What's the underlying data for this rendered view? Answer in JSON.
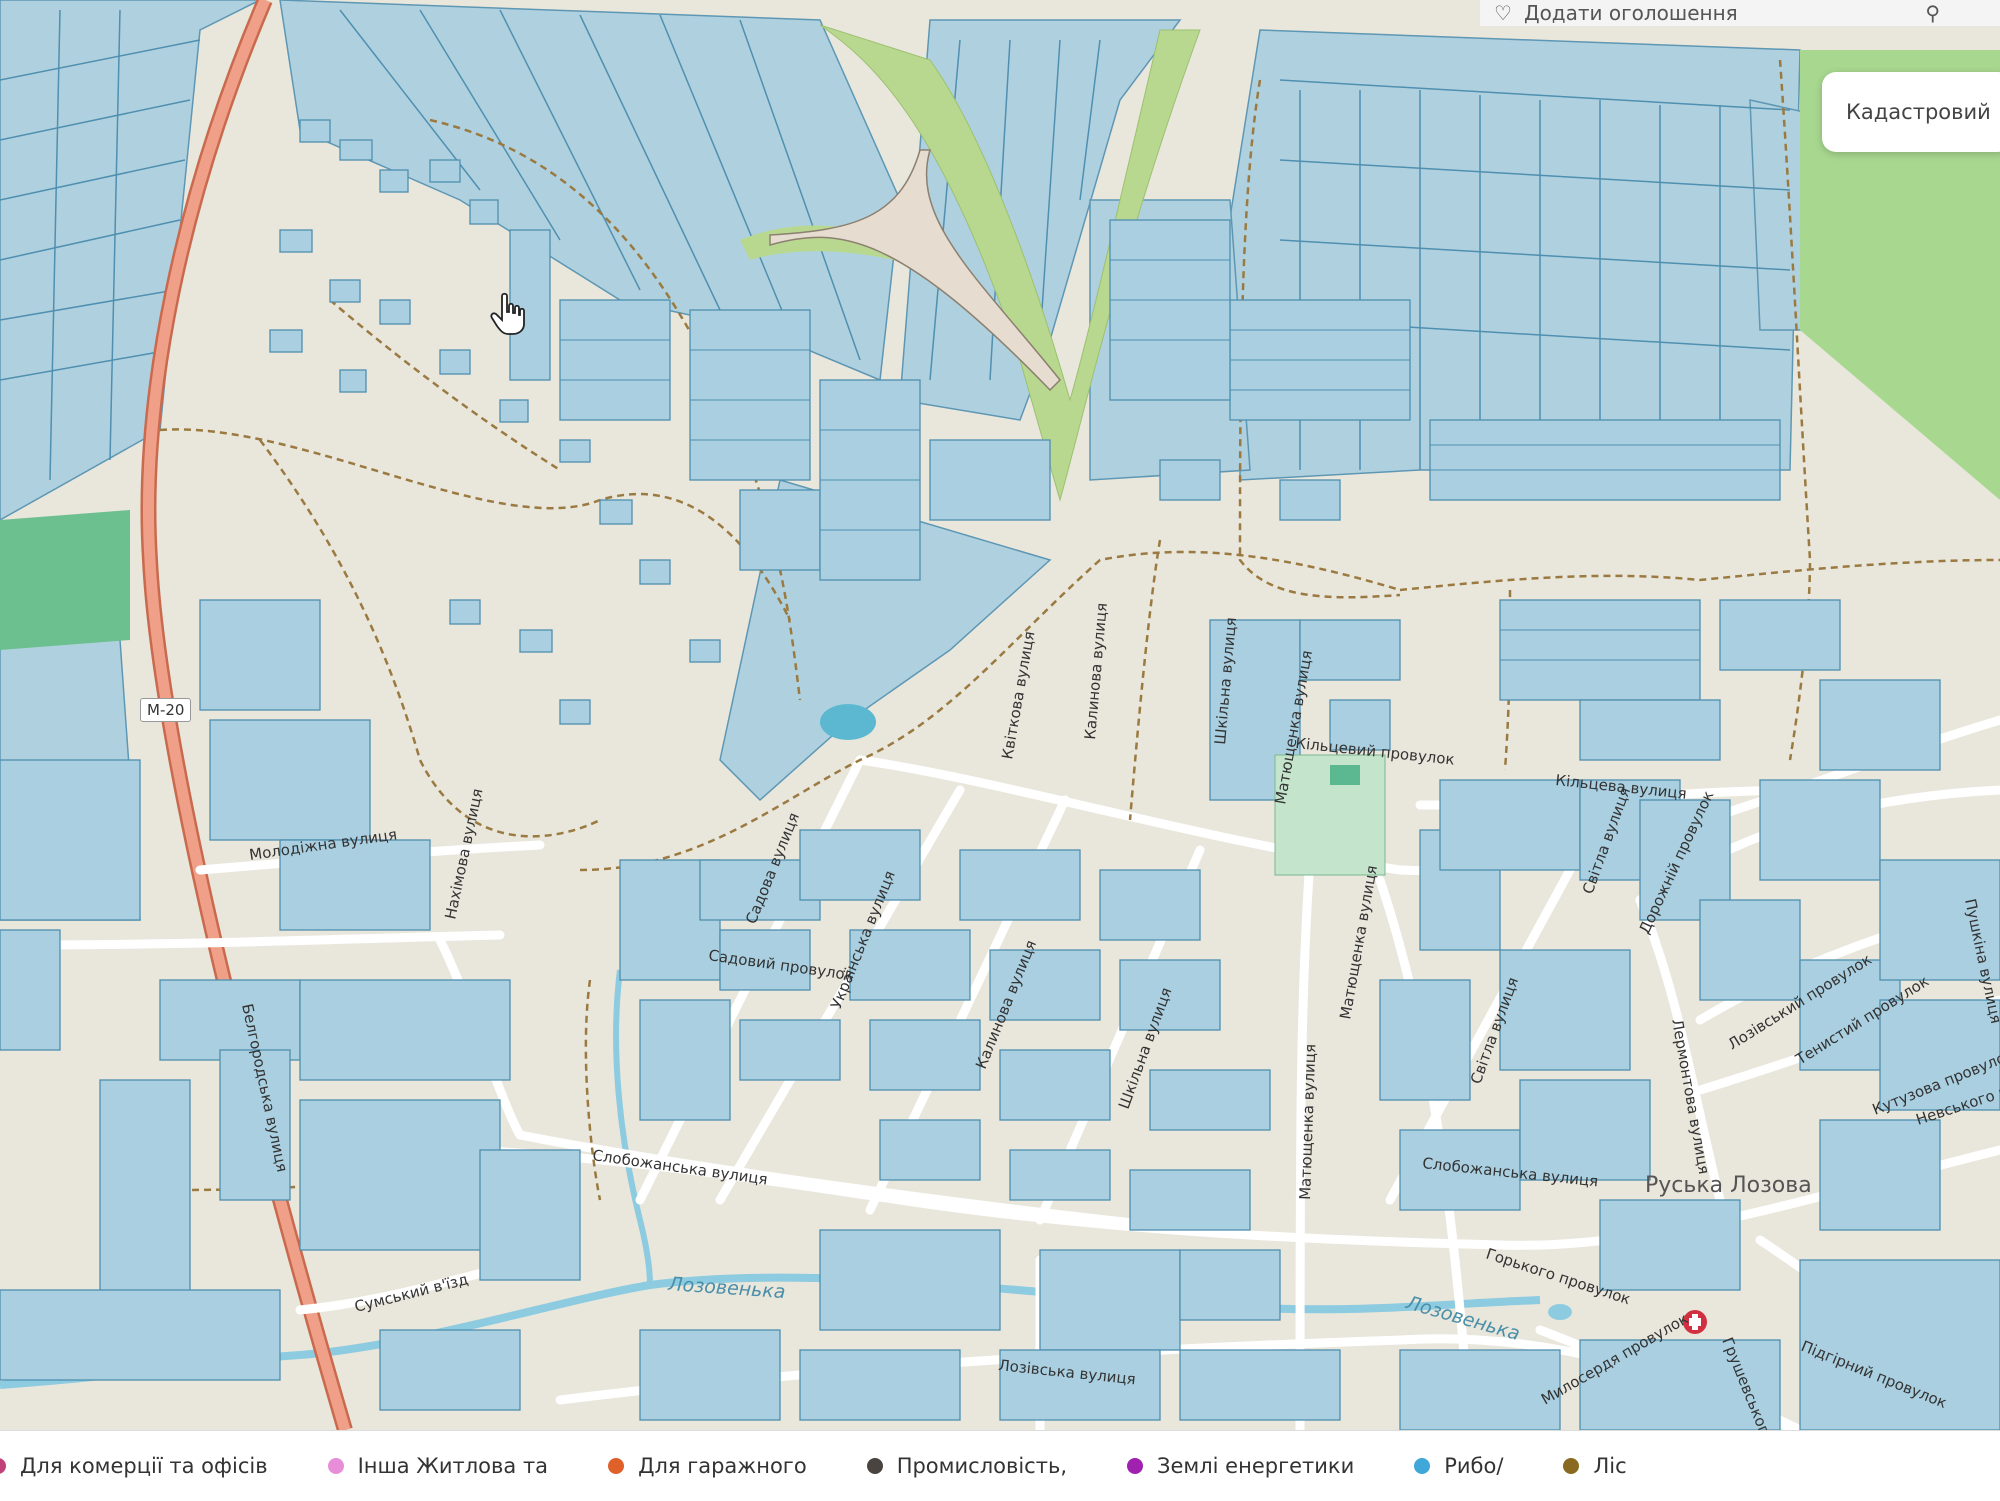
{
  "top_bar": {
    "text": "Додати оголошення",
    "search_icon": "search-icon"
  },
  "layer_button": {
    "label": "Кадастровий"
  },
  "road_badge": "М-20",
  "map_labels": {
    "belgorodska": "Белгородська вулиця",
    "molodizhna": "Молодіжна вулиця",
    "nakhimova": "Нахімова вулиця",
    "sadova": "Садова вулиця",
    "sadovyi_prov": "Садовий провулок",
    "ukrainska": "Українська вулиця",
    "kalynova1": "Калинова вулиця",
    "kalynova2": "Калинова вулиця",
    "kvitkova": "Квіткова вулиця",
    "shkilna1": "Шкільна вулиця",
    "shkilna2": "Шкільна вулиця",
    "matyushchenka1": "Матющенка вулиця",
    "matyushchenka2": "Матющенка вулиця",
    "matyushchenka3": "Матющенка вулиця",
    "kiltsevyi_prov": "Кільцевий провулок",
    "kiltseva": "Кільцева вулиця",
    "svitla1": "Світла вулиця",
    "svitla2": "Світла вулиця",
    "dorozhnyi": "Дорожній провулок",
    "lermontova": "Лермонтова вулиця",
    "lozivskyi_prov": "Лозівський провулок",
    "tenystyi": "Тенистий провулок",
    "kutuzova": "Кутузова провулок",
    "nevskoho": "Невського вулиця",
    "pushkina": "Пушкіна вулиця",
    "slobozhanska1": "Слобожанська вулиця",
    "slobozhanska2": "Слобожанська вулиця",
    "sumskyi": "Сумський в'їзд",
    "gorkoho": "Горького провулок",
    "lozivska": "Лозівська вулиця",
    "myloserdia": "Милосердя провулок",
    "hrushevskoho": "Грушевського",
    "pidhirnyi": "Підгірний провулок",
    "lozovenka1": "Лозовенька",
    "lozovenka2": "Лозовенька",
    "ruska_lozova": "Руська Лозова"
  },
  "legend": [
    {
      "label": "Для комерції та офісів",
      "color": "#c0407a"
    },
    {
      "label": "Інша Житлова та",
      "color": "#e88ed8"
    },
    {
      "label": "Для гаражного",
      "color": "#e0602a"
    },
    {
      "label": "Промисловість,",
      "color": "#4a4440"
    },
    {
      "label": "Землі енергетики",
      "color": "#a020b0"
    },
    {
      "label": "Рибо/",
      "color": "#3fa8d8"
    },
    {
      "label": "Ліс",
      "color": "#8a6a20"
    }
  ],
  "colors": {
    "background": "#e9e6dc",
    "parcel_fill": "#a9cfe0",
    "parcel_stroke": "#4f8fb0",
    "road_main": "#f0a088",
    "forest": "#a8d890",
    "water": "#8ccbe0"
  }
}
